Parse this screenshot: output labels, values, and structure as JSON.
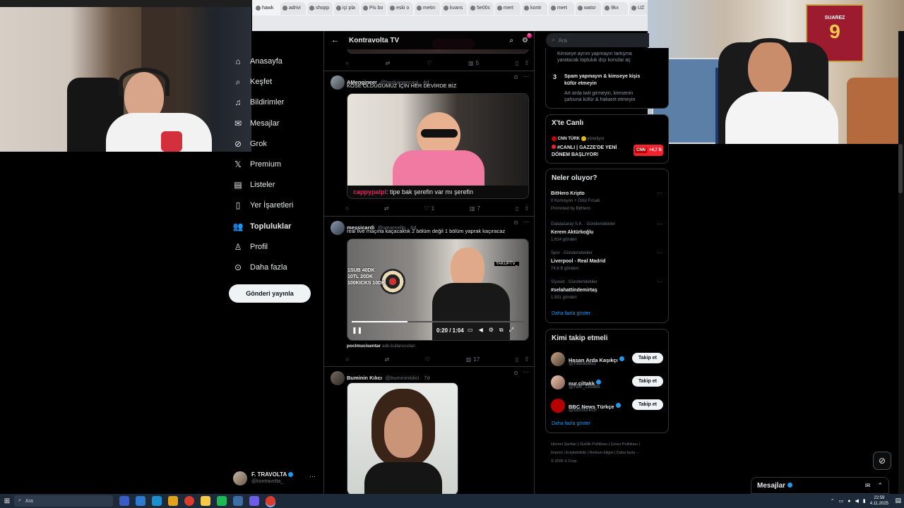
{
  "browser": {
    "tabs": [
      "hawk",
      "adrivi",
      "shopp",
      "içi pla",
      "Pis bo",
      "eski o",
      "metin",
      "kvans",
      "5e00c",
      "mert",
      "kontr",
      "mert",
      "watsr",
      "9kx",
      "UZ"
    ]
  },
  "nav": {
    "items": [
      {
        "label": "Anasayfa",
        "icon": "home-icon",
        "bold": false
      },
      {
        "label": "Keşfet",
        "icon": "search-icon",
        "bold": false
      },
      {
        "label": "Bildirimler",
        "icon": "bell-icon",
        "bold": false
      },
      {
        "label": "Mesajlar",
        "icon": "mail-icon",
        "bold": false
      },
      {
        "label": "Grok",
        "icon": "grok-icon",
        "bold": false
      },
      {
        "label": "Premium",
        "icon": "x-logo-icon",
        "bold": false
      },
      {
        "label": "Listeler",
        "icon": "list-icon",
        "bold": false
      },
      {
        "label": "Yer İşaretleri",
        "icon": "bookmark-icon",
        "bold": false
      },
      {
        "label": "Topluluklar",
        "icon": "communities-icon",
        "bold": true
      },
      {
        "label": "Profil",
        "icon": "person-icon",
        "bold": false
      },
      {
        "label": "Daha fazla",
        "icon": "more-circle-icon",
        "bold": false
      }
    ],
    "post_button": "Gönderi yayınla",
    "profile_name": "F. TRAVOLTA",
    "profile_handle": "@kontravolta_"
  },
  "header": {
    "title": "Kontravolta TV",
    "back": "←",
    "notif_count": "5"
  },
  "tweets": [
    {
      "name": "AMengineer",
      "handle": "@baskanoncagi · 4d",
      "text": "KÖSE OLDUĞUMUZ İÇİN HER DEVİRDE BİZ",
      "caption_user": "cappypalpi",
      "caption_text": ": tipe bak şerefin var mı şerefin",
      "replies": "",
      "retweets": "",
      "likes": "1",
      "views": "7"
    },
    {
      "name": "messicardi",
      "handle": "@wearnello · 6d",
      "text": "real live maçına kaçacaktık 2 bölüm değil 1 bölüm yaprak kaçıracaz",
      "video_time": "0:20 / 1:04",
      "overlay_lines": [
        "1SUB 40DK",
        "10TL 20DK",
        "100KICKS 10DK"
      ],
      "overlay_tag": "YAKUPTV_",
      "credit_user": "poclmucisentar",
      "credit_text": "adlı kullanıcıdan",
      "replies": "",
      "retweets": "",
      "likes": "",
      "views": "17"
    },
    {
      "name": "Buminin Kılıcı",
      "handle": "@bumininkilici · 7d",
      "text": ""
    }
  ],
  "top_actions": {
    "views": "5"
  },
  "right": {
    "search_placeholder": "Ara",
    "rules": {
      "rule_top_line1": "Kimseye ayrım yapmayın tartışma",
      "rule_top_line2": "yaratacak topluluk dışı konular aç",
      "rule3_number": "3",
      "rule3_title_line1": "Spam yapmayın & kimseye kişis",
      "rule3_title_line2": "küfür etmeyin",
      "rule3_body_line1": "Art arda twit girmeyin, kimsenin",
      "rule3_body_line2": "şahsına küfür & hakaret etmeyin"
    },
    "live": {
      "title": "X'te Canlı",
      "source": "CNN TÜRK",
      "status": "yönetiyor",
      "headline_line1": "#CANLI | GAZZE'DE YENİ",
      "headline_line2": "DÖNEM BAŞLIYOR!",
      "count": "+4,7 B"
    },
    "trends": {
      "title": "Neler oluyor?",
      "items": [
        {
          "meta": "",
          "title": "BitHero Kripto",
          "sub": "0 Komisyon + Ödül Fırsatı",
          "count": "Promoted by BitHero"
        },
        {
          "meta": "Galatasaray S.K. · Gündemdekiler",
          "title": "Kerem Aktürkoğlu",
          "sub": "",
          "count": "1.614 gönderi"
        },
        {
          "meta": "Spor · Gündemdekiler",
          "title": "Liverpool - Real Madrid",
          "sub": "",
          "count": "74,8 B gönderi"
        },
        {
          "meta": "Siyaset · Gündemdekiler",
          "title": "#selahattindemirtaş",
          "sub": "",
          "count": "1.931 gönderi"
        }
      ],
      "show_more": "Daha fazla göster"
    },
    "who_to_follow": {
      "title": "Kimi takip etmeli",
      "users": [
        {
          "name": "Hasan Arda Kaşıkçı",
          "handle": "@hakasikci",
          "button": "Takip et"
        },
        {
          "name": "nur.çiltakk",
          "handle": "@Nur_ciltakk",
          "button": "Takip et"
        },
        {
          "name": "BBC News Türkçe",
          "handle": "@bbcturkce",
          "button": "Takip et"
        }
      ],
      "show_more": "Daha fazla göster"
    },
    "footer_line1": "Hizmet Şartları  |  Gizlilik Politikası  |  Çerez Politikası  |",
    "footer_line2": "Imprint  |  Erişilebilirlik  |  Reklam bilgisi  |  Daha fazla ···",
    "footer_line3": "© 2025 X Corp."
  },
  "messages": {
    "title": "Mesajlar"
  },
  "taskbar": {
    "search": "Ara",
    "time": "22:59",
    "date": "4.11.2025"
  }
}
